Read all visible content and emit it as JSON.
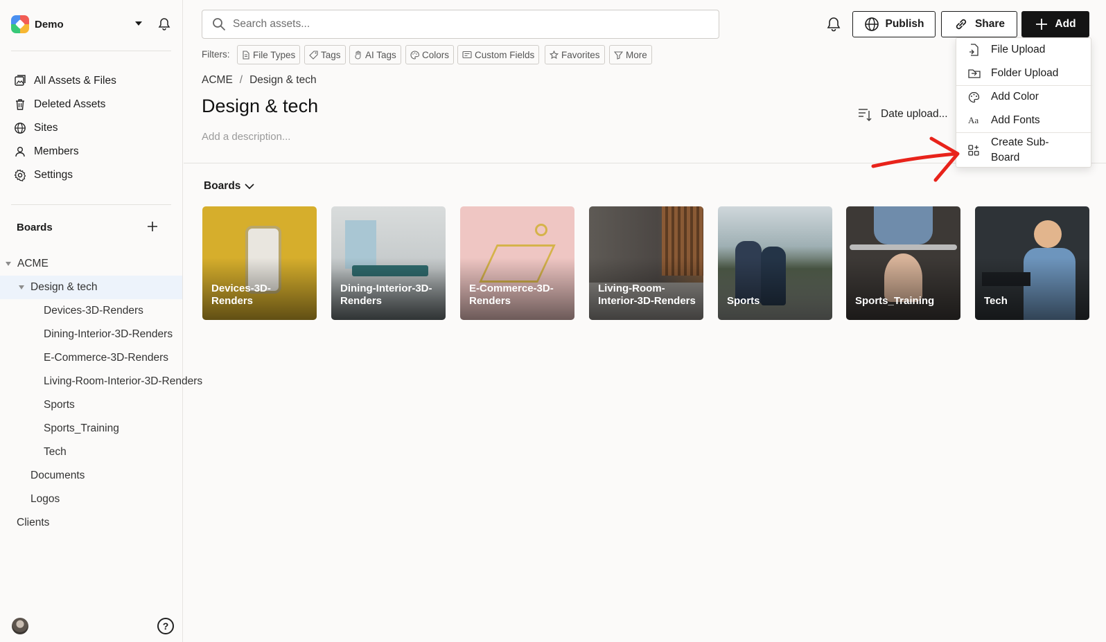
{
  "workspace": {
    "name": "Demo"
  },
  "sidebar": {
    "nav": [
      {
        "label": "All Assets & Files",
        "icon": "assets-icon"
      },
      {
        "label": "Deleted Assets",
        "icon": "trash-icon"
      },
      {
        "label": "Sites",
        "icon": "globe-icon"
      },
      {
        "label": "Members",
        "icon": "user-icon"
      },
      {
        "label": "Settings",
        "icon": "gear-icon"
      }
    ],
    "boards_heading": "Boards",
    "tree": {
      "root": "ACME",
      "selected": "Design & tech",
      "children": [
        "Devices-3D-Renders",
        "Dining-Interior-3D-Renders",
        "E-Commerce-3D-Renders",
        "Living-Room-Interior-3D-Renders",
        "Sports",
        "Sports_Training",
        "Tech"
      ],
      "siblings": [
        "Documents",
        "Logos"
      ],
      "other_root": "Clients"
    }
  },
  "search": {
    "placeholder": "Search assets..."
  },
  "header": {
    "publish": "Publish",
    "share": "Share",
    "add": "Add"
  },
  "filters": {
    "label": "Filters:",
    "chips": [
      "File Types",
      "Tags",
      "AI Tags",
      "Colors",
      "Custom Fields",
      "Favorites",
      "More"
    ]
  },
  "breadcrumb": [
    "ACME",
    "/",
    "Design & tech"
  ],
  "page": {
    "title": "Design & tech",
    "description_placeholder": "Add a description...",
    "sort_label": "Date upload..."
  },
  "boards_section": {
    "label": "Boards"
  },
  "cards": [
    {
      "label": "Devices-3D-Renders",
      "bg": "#d7b133"
    },
    {
      "label": "Dining-Interior-3D-Renders",
      "bg": "#b9c3c6"
    },
    {
      "label": "E-Commerce-3D-Renders",
      "bg": "#efc9c7"
    },
    {
      "label": "Living-Room-Interior-3D-Renders",
      "bg": "#5b5650"
    },
    {
      "label": "Sports",
      "bg": "#7f8f92"
    },
    {
      "label": "Sports_Training",
      "bg": "#4b4642"
    },
    {
      "label": "Tech",
      "bg": "#3a4650"
    }
  ],
  "add_menu": {
    "items": [
      {
        "label": "File Upload",
        "icon": "file-upload-icon"
      },
      {
        "label": "Folder Upload",
        "icon": "folder-upload-icon"
      },
      {
        "label": "Add Color",
        "icon": "palette-icon"
      },
      {
        "label": "Add Fonts",
        "icon": "font-icon"
      },
      {
        "label": "Create Sub-Board",
        "icon": "sub-board-icon"
      }
    ]
  },
  "annotation": {
    "arrow_color": "#e8231b"
  }
}
